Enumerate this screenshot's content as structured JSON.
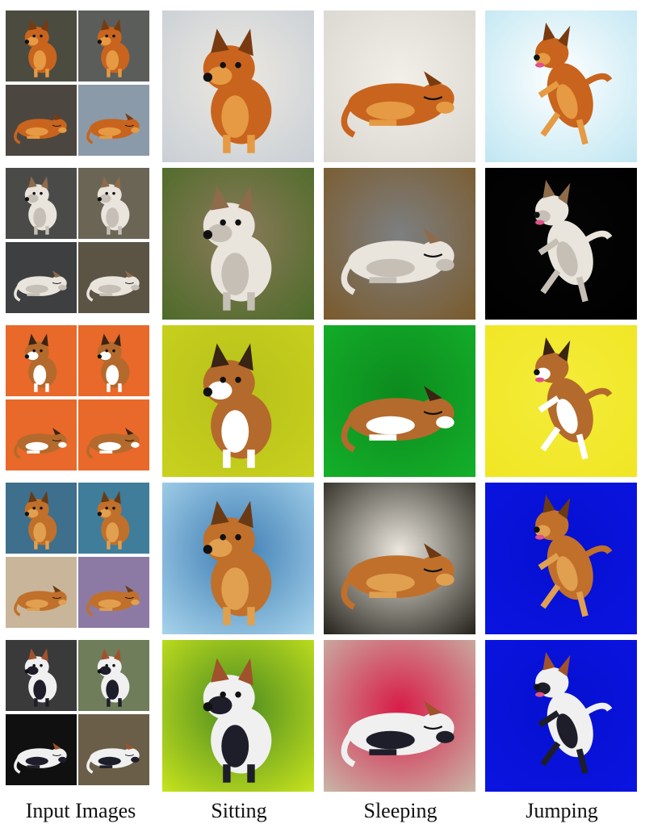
{
  "captions": {
    "input": "Input Images",
    "sitting": "Sitting",
    "sleeping": "Sleeping",
    "jumping": "Jumping"
  },
  "rows": [
    {
      "breed": "chow-chow",
      "dog_colors": [
        "#c8641e",
        "#e59a43",
        "#7a3a10"
      ],
      "input_bgs": [
        "#4b4b40",
        "#5a5d5a",
        "#4c4640",
        "#8b9aa8"
      ],
      "sitting_bg": [
        "#c9cfd6",
        "#ece8e0"
      ],
      "sleeping_bg": [
        "#d9d6d0",
        "#f2efe8"
      ],
      "jumping_bg": [
        "#bfe6f2",
        "#ffffff"
      ]
    },
    {
      "breed": "white-terrier",
      "dog_colors": [
        "#e9e4dc",
        "#c5bfb6",
        "#8e6b4a"
      ],
      "input_bgs": [
        "#4a4a48",
        "#6b6556",
        "#3e3f40",
        "#5b5344"
      ],
      "sitting_bg": [
        "#4c6b28",
        "#8b7a5a"
      ],
      "sleeping_bg": [
        "#7a5a2a",
        "#7d7f82"
      ],
      "jumping_bg": [
        "#000000",
        "#050505"
      ]
    },
    {
      "breed": "corgi",
      "dog_colors": [
        "#b46a2c",
        "#ffffff",
        "#3a2414"
      ],
      "input_bgs": [
        "#e8692a",
        "#e8692a",
        "#e8692a",
        "#e8692a"
      ],
      "sitting_bg": [
        "#c9d21e",
        "#b6c01a"
      ],
      "sleeping_bg": [
        "#14b02a",
        "#0c8a1e"
      ],
      "jumping_bg": [
        "#f0e624",
        "#f4ec3a"
      ]
    },
    {
      "breed": "golden-retriever",
      "dog_colors": [
        "#c0702a",
        "#e0a050",
        "#6a3a14"
      ],
      "input_bgs": [
        "#3e6f8c",
        "#3f7d9a",
        "#c9b69a",
        "#8c7aa4"
      ],
      "sitting_bg": [
        "#a8d4ec",
        "#3f7eb4"
      ],
      "sleeping_bg": [
        "#222018",
        "#ece8e0"
      ],
      "jumping_bg": [
        "#0a14e0",
        "#0610d0"
      ]
    },
    {
      "breed": "border-collie",
      "dog_colors": [
        "#f0f0f0",
        "#1e1e2a",
        "#a0522d"
      ],
      "input_bgs": [
        "#3a3a3a",
        "#6f7d5a",
        "#101010",
        "#6a5e48"
      ],
      "sitting_bg": [
        "#c8e41e",
        "#4a8a20"
      ],
      "sleeping_bg": [
        "#c8b8a8",
        "#d81c48"
      ],
      "jumping_bg": [
        "#0a14e0",
        "#0610d0"
      ]
    }
  ]
}
